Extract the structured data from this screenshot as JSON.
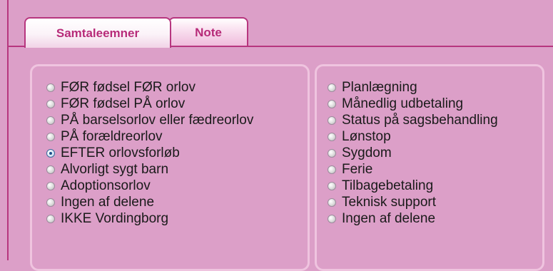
{
  "tabs": [
    {
      "label": "Samtaleemner",
      "active": true
    },
    {
      "label": "Note",
      "active": false
    }
  ],
  "left_options": [
    {
      "label": "FØR fødsel FØR orlov",
      "checked": false
    },
    {
      "label": "FØR fødsel PÅ orlov",
      "checked": false
    },
    {
      "label": "PÅ barselsorlov eller fædreorlov",
      "checked": false
    },
    {
      "label": "PÅ forældreorlov",
      "checked": false
    },
    {
      "label": "EFTER orlovsforløb",
      "checked": true
    },
    {
      "label": "Alvorligt sygt barn",
      "checked": false
    },
    {
      "label": "Adoptionsorlov",
      "checked": false
    },
    {
      "label": "Ingen af delene",
      "checked": false
    },
    {
      "label": "IKKE Vordingborg",
      "checked": false
    }
  ],
  "right_options": [
    {
      "label": "Planlægning",
      "checked": false
    },
    {
      "label": "Månedlig udbetaling",
      "checked": false
    },
    {
      "label": "Status på sagsbehandling",
      "checked": false
    },
    {
      "label": "Lønstop",
      "checked": false
    },
    {
      "label": "Sygdom",
      "checked": false
    },
    {
      "label": "Ferie",
      "checked": false
    },
    {
      "label": "Tilbagebetaling",
      "checked": false
    },
    {
      "label": "Teknisk support",
      "checked": false
    },
    {
      "label": "Ingen af delene",
      "checked": false
    }
  ],
  "colors": {
    "background": "#dc9fc8",
    "accent": "#b7367f",
    "tab_text": "#b72b79",
    "panel_border": "#efc4df"
  }
}
